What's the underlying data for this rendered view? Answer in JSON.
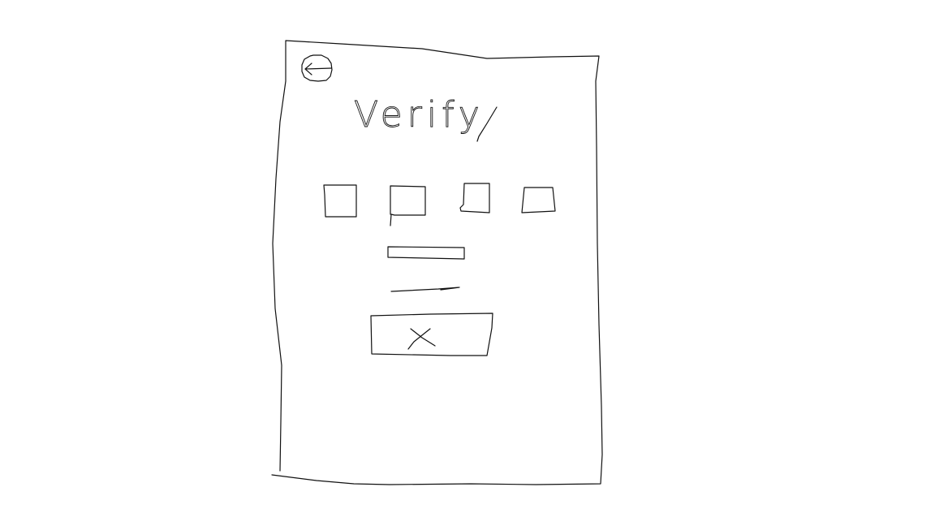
{
  "screen": {
    "title": "Verify"
  },
  "colors": {
    "ink": "#111111",
    "background": "#ffffff"
  },
  "icons": {
    "back": "back-arrow-icon",
    "submit": "close-x-icon"
  },
  "verification_code": {
    "box_count": 4
  }
}
